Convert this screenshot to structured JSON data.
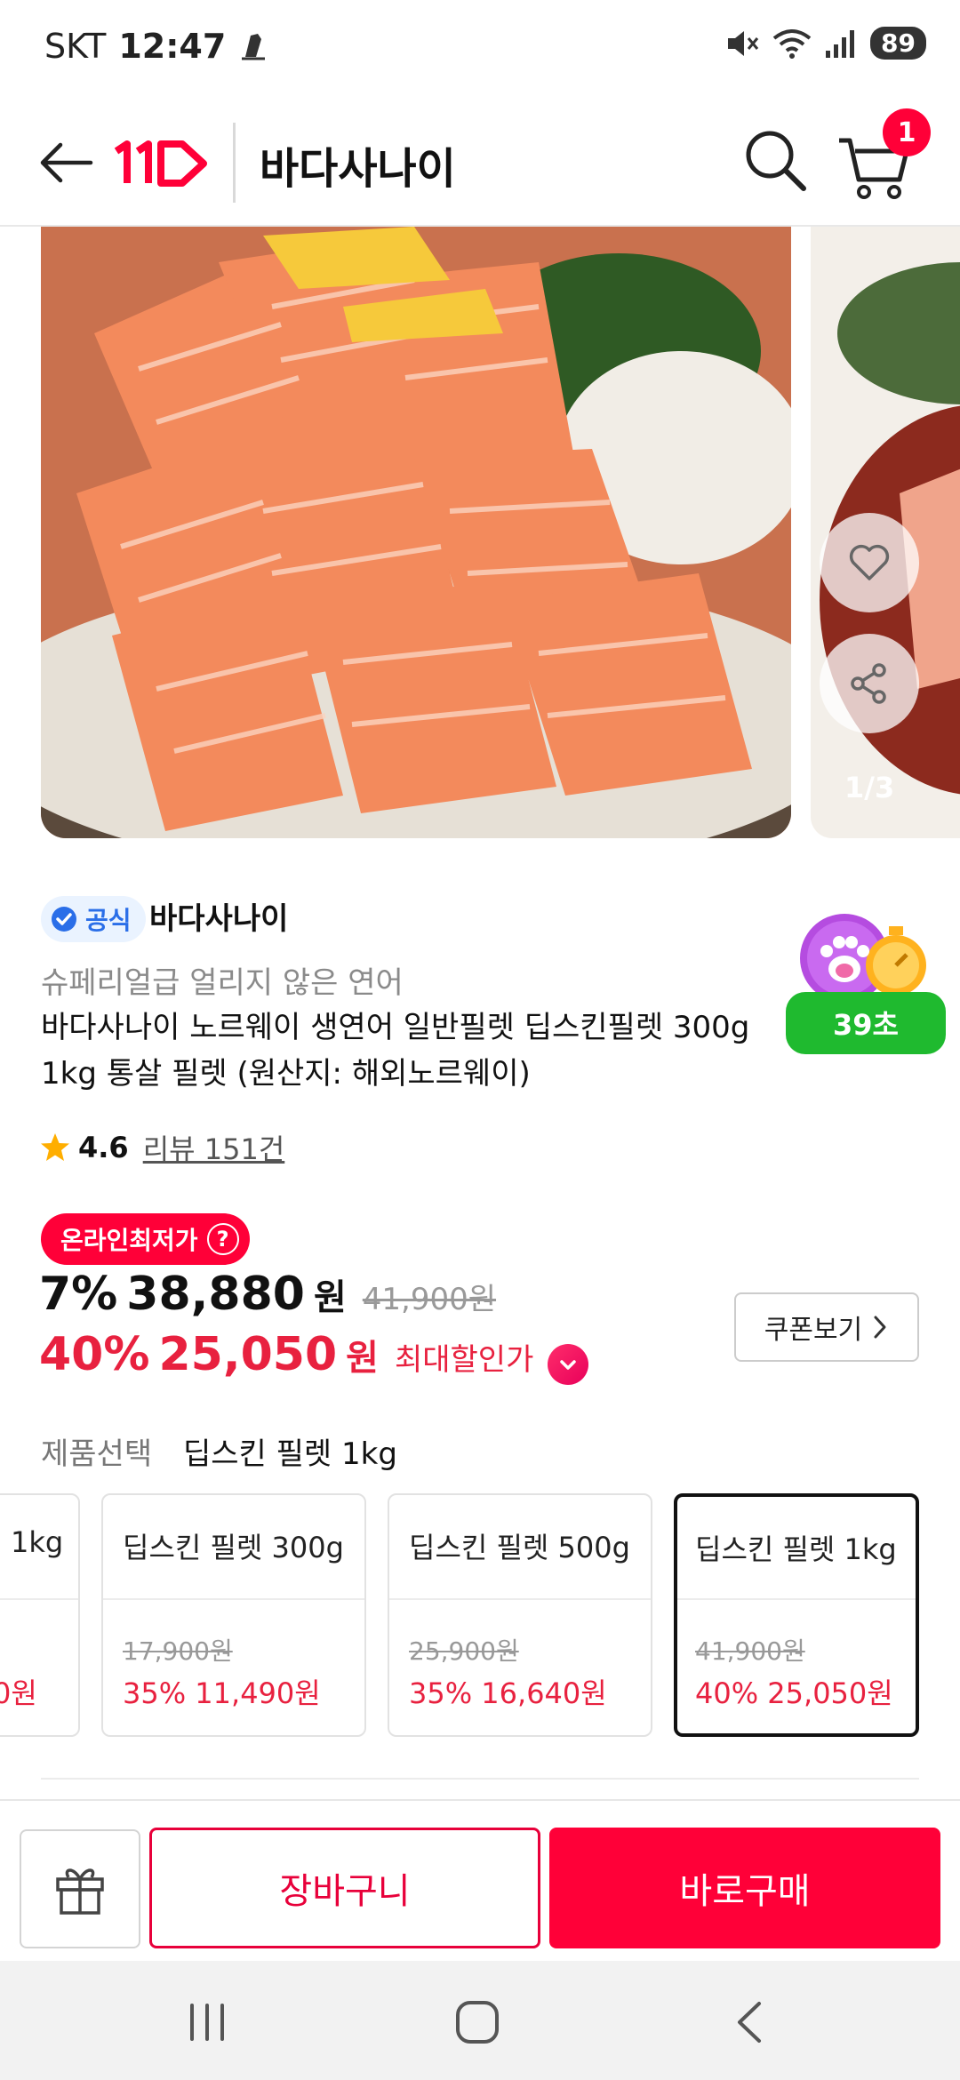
{
  "status_bar": {
    "carrier": "SKT",
    "time": "12:47",
    "battery": "89"
  },
  "header": {
    "title": "바다사나이",
    "cart_count": "1"
  },
  "carousel": {
    "page_indicator": "1/3"
  },
  "seller": {
    "official_label": "공식",
    "name": "바다사나이"
  },
  "product": {
    "subtitle": "슈페리얼급 얼리지 않은 연어",
    "title": "바다사나이 노르웨이 생연어 일반필렛 딥스킨필렛 300g 1kg 통살 필렛 (원산지: 해외노르웨이)"
  },
  "timer": {
    "label": "39초"
  },
  "rating": {
    "value": "4.6",
    "reviews": "리뷰 151건"
  },
  "pricing": {
    "lowest_badge": "온라인최저가",
    "lowest_help": "?",
    "rate1": "7%",
    "price1": "38,880",
    "won": "원",
    "original": "41,900원",
    "rate2": "40%",
    "price2": "25,050",
    "max_discount_label": "최대할인가",
    "coupon_button": "쿠폰보기"
  },
  "options": {
    "label": "제품선택",
    "selected_value": "딥스킨 필렛 1kg",
    "cards": [
      {
        "name": "1kg",
        "original": "",
        "price": "0원"
      },
      {
        "name": "딥스킨 필렛 300g",
        "original": "17,900원",
        "price": "35% 11,490원"
      },
      {
        "name": "딥스킨 필렛 500g",
        "original": "25,900원",
        "price": "35% 16,640원"
      },
      {
        "name": "딥스킨 필렛 1kg",
        "original": "41,900원",
        "price": "40% 25,050원"
      }
    ]
  },
  "bottom_bar": {
    "cart_button": "장바구니",
    "buy_button": "바로구매"
  },
  "colors": {
    "accent": "#ff0038",
    "price_red": "#e8213f",
    "timer_green": "#1fba2f",
    "official_blue": "#2a6ee8"
  }
}
